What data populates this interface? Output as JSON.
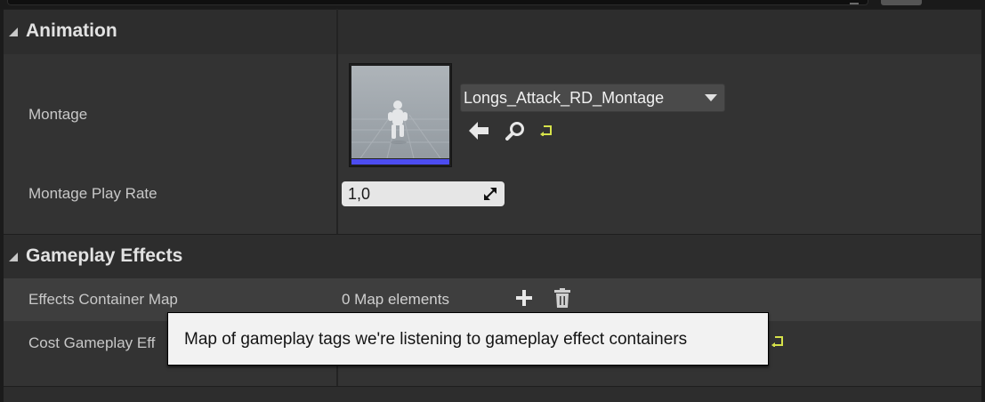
{
  "categories": {
    "animation": {
      "title": "Animation"
    },
    "gameplay_effects": {
      "title": "Gameplay Effects"
    }
  },
  "montage": {
    "label": "Montage",
    "asset_name": "Longs_Attack_RD_Montage",
    "thumbnail_icon": "animation-montage-thumbnail",
    "buttons": [
      "use-selected-asset-icon",
      "browse-asset-icon",
      "reset-to-default-icon"
    ]
  },
  "montage_play_rate": {
    "label": "Montage Play Rate",
    "value": "1,0"
  },
  "effects_container_map": {
    "label": "Effects Container Map",
    "value": "0 Map elements",
    "buttons": [
      "add-element-icon",
      "remove-all-icon"
    ]
  },
  "cost_gameplay_effect": {
    "label_visible": "Cost Gameplay Eff"
  },
  "tooltip": {
    "text": "Map of gameplay tags we're listening to gameplay effect containers"
  },
  "colors": {
    "panel_bg": "#333333",
    "header_bg": "#2d2d2d",
    "highlight_row": "#3e3e3e",
    "reset_icon": "#d6e24a",
    "thumb_bar": "#4c4cf0"
  }
}
